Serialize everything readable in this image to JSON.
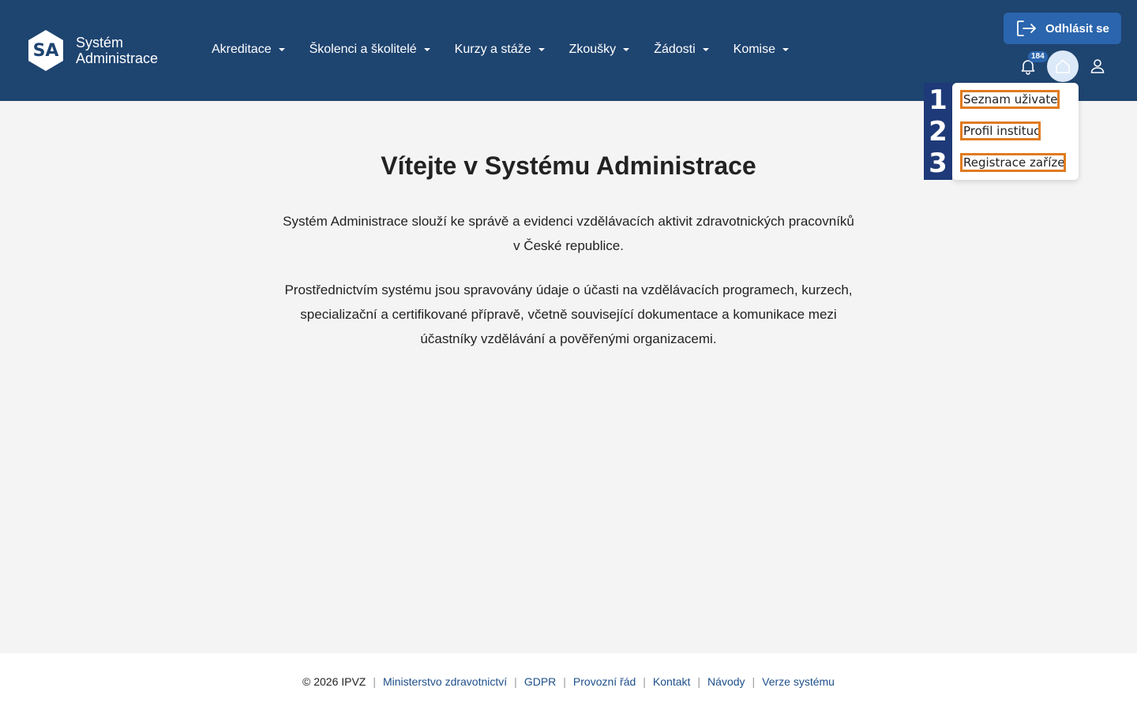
{
  "header": {
    "logo_initials": "SA",
    "logo_line1": "Systém",
    "logo_line2": "Administrace",
    "nav": [
      {
        "label": "Akreditace"
      },
      {
        "label": "Školenci a školitelé"
      },
      {
        "label": "Kurzy a stáže"
      },
      {
        "label": "Zkoušky"
      },
      {
        "label": "Žádosti"
      },
      {
        "label": "Komise"
      }
    ],
    "logout_label": "Odhlásit se",
    "notification_count": "184"
  },
  "dropdown": {
    "items": [
      {
        "number": "1",
        "label": "Seznam uživatelů"
      },
      {
        "number": "2",
        "label": "Profil instituce"
      },
      {
        "number": "3",
        "label": "Registrace zařízení"
      }
    ]
  },
  "main": {
    "title": "Vítejte v Systému Administrace",
    "paragraph1_line1": "Systém Administrace slouží ke správě a evidenci vzdělávacích aktivit zdravotnických pracovníků",
    "paragraph1_line2": "v České republice.",
    "paragraph2_line1": "Prostřednictvím systému jsou spravovány údaje o účasti na vzdělávacích programech, kurzech,",
    "paragraph2_line2": "specializační a certifikované přípravě, včetně související dokumentace a komunikace mezi",
    "paragraph2_line3": "účastníky vzdělávání a pověřenými organizacemi."
  },
  "footer": {
    "copyright": "© 2026 IPVZ",
    "links": [
      "Ministerstvo zdravotnictví",
      "GDPR",
      "Provozní řád",
      "Kontakt",
      "Návody",
      "Verze systému"
    ]
  },
  "colors": {
    "header_bg": "#1e4470",
    "button_bg": "#2a65ad",
    "highlight": "#e07b1f",
    "marker_bg": "#1e3a78"
  },
  "icons": {
    "logout": "logout-icon",
    "bell": "bell-icon",
    "home": "home-icon",
    "user": "user-icon",
    "caret": "chevron-down-icon"
  }
}
